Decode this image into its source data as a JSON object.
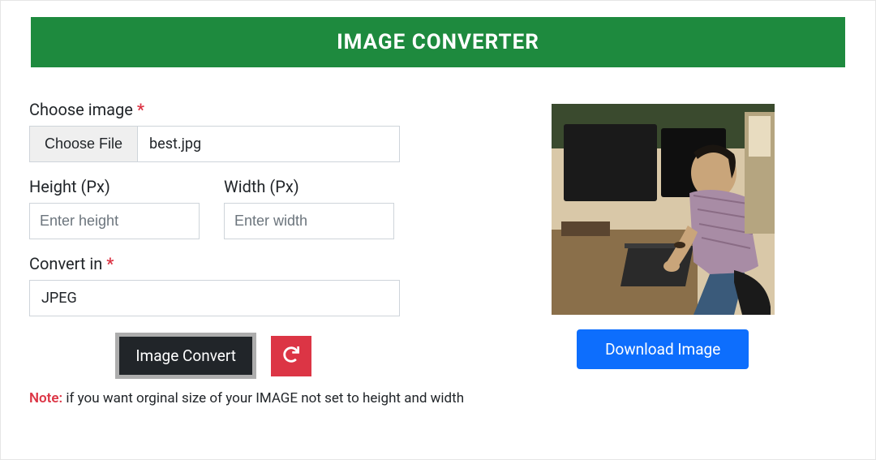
{
  "header": {
    "title": "IMAGE CONVERTER"
  },
  "form": {
    "choose_image": {
      "label": "Choose image",
      "required_mark": "*",
      "button_label": "Choose File",
      "file_name": "best.jpg"
    },
    "height": {
      "label": "Height (Px)",
      "placeholder": "Enter height",
      "value": ""
    },
    "width": {
      "label": "Width (Px)",
      "placeholder": "Enter width",
      "value": ""
    },
    "convert_in": {
      "label": "Convert in",
      "required_mark": "*",
      "selected": "JPEG"
    },
    "convert_button": "Image Convert",
    "download_button": "Download Image"
  },
  "note": {
    "label": "Note:",
    "text": " if you want orginal size of your IMAGE not set to height and width"
  }
}
